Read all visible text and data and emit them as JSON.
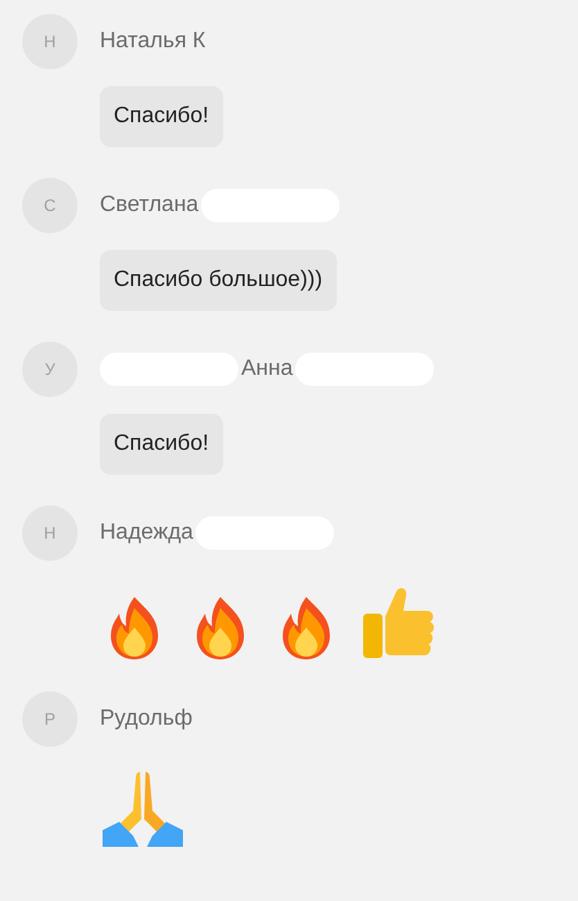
{
  "messages": [
    {
      "avatar": "Н",
      "name_parts": [
        {
          "kind": "text",
          "text": "Наталья К"
        }
      ],
      "content": {
        "kind": "text",
        "text": "Спасибо!"
      }
    },
    {
      "avatar": "С",
      "name_parts": [
        {
          "kind": "text",
          "text": "Светлана"
        },
        {
          "kind": "redacted"
        }
      ],
      "content": {
        "kind": "text",
        "text": "Спасибо большое)))"
      }
    },
    {
      "avatar": "У",
      "name_parts": [
        {
          "kind": "redacted"
        },
        {
          "kind": "text",
          "text": "Анна"
        },
        {
          "kind": "redacted"
        }
      ],
      "content": {
        "kind": "text",
        "text": "Спасибо!"
      }
    },
    {
      "avatar": "Н",
      "name_parts": [
        {
          "kind": "text",
          "text": "Надежда"
        },
        {
          "kind": "redacted"
        }
      ],
      "content": {
        "kind": "emoji",
        "emojis": [
          {
            "kind": "fire"
          },
          {
            "kind": "fire"
          },
          {
            "kind": "fire"
          },
          {
            "kind": "thumbs_up"
          }
        ]
      }
    },
    {
      "avatar": "Р",
      "name_parts": [
        {
          "kind": "text",
          "text": "Рудольф"
        }
      ],
      "content": {
        "kind": "emoji",
        "emojis": [
          {
            "kind": "praying_hands"
          }
        ]
      }
    }
  ]
}
